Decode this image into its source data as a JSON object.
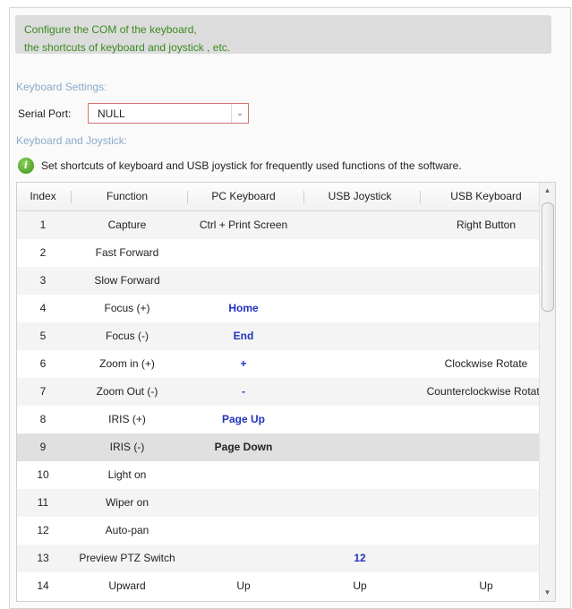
{
  "hint": {
    "line1": "Configure the COM of the keyboard,",
    "line2": "the shortcuts of keyboard and joystick , etc."
  },
  "keyboard_settings": {
    "title": "Keyboard Settings:",
    "serial_port_label": "Serial Port:",
    "serial_port_value": "NULL"
  },
  "keyboard_joystick": {
    "title": "Keyboard and Joystick:",
    "tip": "Set shortcuts of keyboard and USB joystick for frequently used functions of the software."
  },
  "table": {
    "headers": [
      "Index",
      "Function",
      "PC Keyboard",
      "USB Joystick",
      "USB Keyboard"
    ],
    "rows": [
      {
        "index": "1",
        "function": "Capture",
        "pc": "Ctrl + Print Screen",
        "js": "",
        "kb": "Right Button",
        "pc_style": ""
      },
      {
        "index": "2",
        "function": "Fast Forward",
        "pc": "",
        "js": "",
        "kb": "",
        "pc_style": ""
      },
      {
        "index": "3",
        "function": "Slow Forward",
        "pc": "",
        "js": "",
        "kb": "",
        "pc_style": ""
      },
      {
        "index": "4",
        "function": "Focus (+)",
        "pc": "Home",
        "js": "",
        "kb": "",
        "pc_style": "blue"
      },
      {
        "index": "5",
        "function": "Focus (-)",
        "pc": "End",
        "js": "",
        "kb": "",
        "pc_style": "blue"
      },
      {
        "index": "6",
        "function": "Zoom in (+)",
        "pc": "+",
        "js": "",
        "kb": "Clockwise Rotate",
        "pc_style": "blue"
      },
      {
        "index": "7",
        "function": "Zoom Out (-)",
        "pc": "-",
        "js": "",
        "kb": "Counterclockwise Rotate",
        "pc_style": "blue"
      },
      {
        "index": "8",
        "function": "IRIS (+)",
        "pc": "Page Up",
        "js": "",
        "kb": "",
        "pc_style": "blue"
      },
      {
        "index": "9",
        "function": "IRIS (-)",
        "pc": "Page Down",
        "js": "",
        "kb": "",
        "pc_style": "bold",
        "selected": true
      },
      {
        "index": "10",
        "function": "Light on",
        "pc": "",
        "js": "",
        "kb": "",
        "pc_style": ""
      },
      {
        "index": "11",
        "function": "Wiper on",
        "pc": "",
        "js": "",
        "kb": "",
        "pc_style": ""
      },
      {
        "index": "12",
        "function": "Auto-pan",
        "pc": "",
        "js": "",
        "kb": "",
        "pc_style": ""
      },
      {
        "index": "13",
        "function": "Preview PTZ Switch",
        "pc": "",
        "js": "12",
        "kb": "",
        "pc_style": "",
        "js_style": "blue"
      },
      {
        "index": "14",
        "function": "Upward",
        "pc": "Up",
        "js": "Up",
        "kb": "Up",
        "pc_style": ""
      }
    ]
  },
  "colors": {
    "hint_text": "#3c8a1e",
    "section_title": "#8aaac8",
    "select_border": "#d37272",
    "shortcut_blue": "#2233bb"
  },
  "icons": {
    "tip": "info-icon",
    "dropdown": "chevron-down-icon",
    "scroll_up": "scroll-up-icon",
    "scroll_down": "scroll-down-icon"
  }
}
